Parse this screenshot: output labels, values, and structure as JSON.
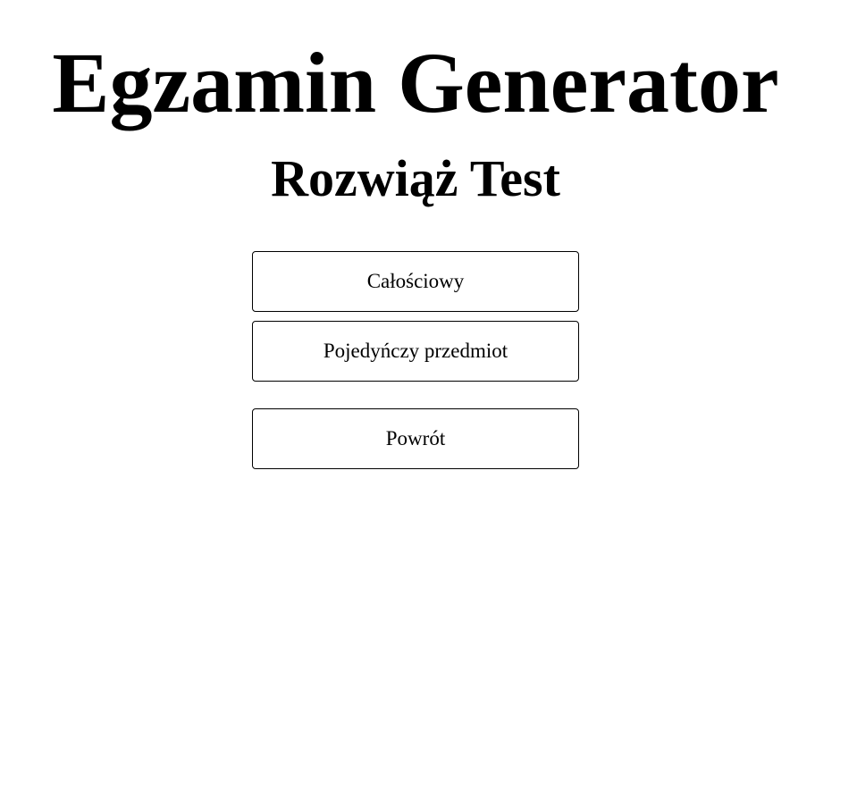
{
  "header": {
    "title": "Egzamin Generator",
    "subtitle": "Rozwiąż Test"
  },
  "menu": {
    "full_test_label": "Całościowy",
    "single_subject_label": "Pojedyńczy przedmiot",
    "back_label": "Powrót"
  },
  "colors": {
    "text": "#000000",
    "background": "#ffffff",
    "button_border": "#000000"
  }
}
